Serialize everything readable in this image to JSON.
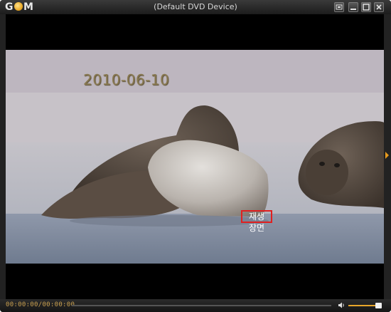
{
  "window": {
    "title": "(Default DVD Device)",
    "logo_text": "GOM"
  },
  "titlebar_buttons": [
    "settings-icon",
    "minimize-icon",
    "maximize-icon",
    "close-icon"
  ],
  "video": {
    "date_stamp": "2010-06-10",
    "subtitle_line1": "재생",
    "subtitle_line2": "장면"
  },
  "controls": {
    "time_display": "00:00:00/00:00:00",
    "seek_progress": 0.0,
    "volume_level": 0.85
  },
  "colors": {
    "accent": "#e8a62a",
    "highlight_box": "#e02020",
    "window_bg": "#1a1a1a"
  }
}
